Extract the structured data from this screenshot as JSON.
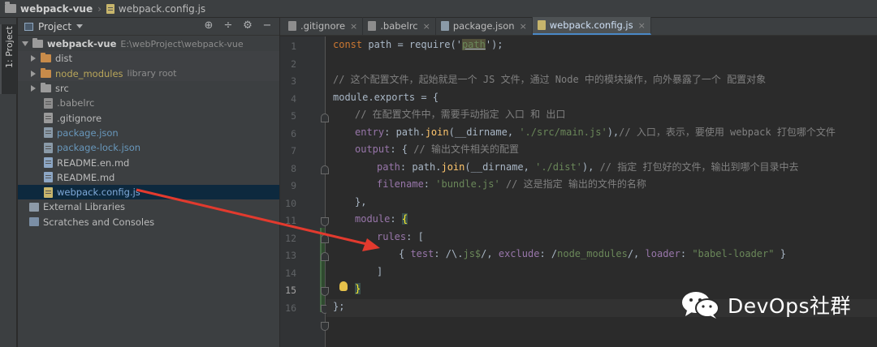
{
  "breadcrumb": {
    "project": "webpack-vue",
    "file": "webpack.config.js"
  },
  "toolstrip": {
    "project_tab": "1: Project"
  },
  "project_panel": {
    "title": "Project",
    "tools": [
      "target-icon",
      "collapse-icon",
      "gear-icon",
      "hide-icon"
    ],
    "tree": [
      {
        "label": "webpack-vue",
        "extra": "E:\\webProject\\webpack-vue",
        "type": "root"
      },
      {
        "label": "dist",
        "type": "folder"
      },
      {
        "label": "node_modules",
        "extra": "library root",
        "type": "folder-lib"
      },
      {
        "label": "src",
        "type": "folder"
      },
      {
        "label": ".babelrc",
        "type": "file"
      },
      {
        "label": ".gitignore",
        "type": "file"
      },
      {
        "label": "package.json",
        "type": "json"
      },
      {
        "label": "package-lock.json",
        "type": "json"
      },
      {
        "label": "README.en.md",
        "type": "md"
      },
      {
        "label": "README.md",
        "type": "md"
      },
      {
        "label": "webpack.config.js",
        "type": "js",
        "selected": true
      },
      {
        "label": "External Libraries",
        "type": "lib"
      },
      {
        "label": "Scratches and Consoles",
        "type": "scratch"
      }
    ]
  },
  "editor": {
    "tabs": [
      {
        "label": ".gitignore",
        "active": false
      },
      {
        "label": ".babelrc",
        "active": false
      },
      {
        "label": "package.json",
        "active": false
      },
      {
        "label": "webpack.config.js",
        "active": true
      }
    ],
    "line_numbers": [
      "1",
      "2",
      "3",
      "4",
      "5",
      "6",
      "7",
      "8",
      "9",
      "10",
      "11",
      "12",
      "13",
      "14",
      "15",
      "16"
    ],
    "lines": {
      "l1": {
        "kw": "const",
        "a": " path = ",
        "fn": "require",
        "b": "('",
        "path": "path",
        "c": "');"
      },
      "l3": "// 这个配置文件，起始就是一个 JS 文件，通过 Node 中的模块操作，向外暴露了一个 配置对象",
      "l4": {
        "a": "module",
        "b": ".exports = {"
      },
      "l5": "// 在配置文件中，需要手动指定 入口 和 出口",
      "l6": {
        "prop": "entry",
        "a": ": path.",
        "fn": "join",
        "b": "(__dirname, ",
        "str": "'./src/main.js'",
        "c": "),",
        "cm": "// 入口，表示，要使用 webpack 打包哪个文件"
      },
      "l7": {
        "prop": "output",
        "a": ": { ",
        "cm": "// 输出文件相关的配置"
      },
      "l8": {
        "prop": "path",
        "a": ": path.",
        "fn": "join",
        "b": "(__dirname, ",
        "str": "'./dist'",
        "c": "), ",
        "cm": "// 指定 打包好的文件，输出到哪个目录中去"
      },
      "l9": {
        "prop": "filename",
        "a": ": ",
        "str": "'bundle.js'",
        "cm": " // 这是指定 输出的文件的名称"
      },
      "l10": "},",
      "l11": {
        "prop": "module",
        "a": ": ",
        "br": "{"
      },
      "l12": {
        "prop": "rules",
        "a": ": ["
      },
      "l13": {
        "a": "{ ",
        "p1": "test",
        "b": ": /\\.",
        "re": "js$",
        "c": "/, ",
        "p2": "exclude",
        "d": ": /",
        "re2": "node_modules",
        "e": "/, ",
        "p3": "loader",
        "f": ": ",
        "str": "\"babel-loader\"",
        "g": " }"
      },
      "l14": "]",
      "l15": "}",
      "l16": "};"
    }
  },
  "watermark": {
    "text": "DevOps社群"
  }
}
